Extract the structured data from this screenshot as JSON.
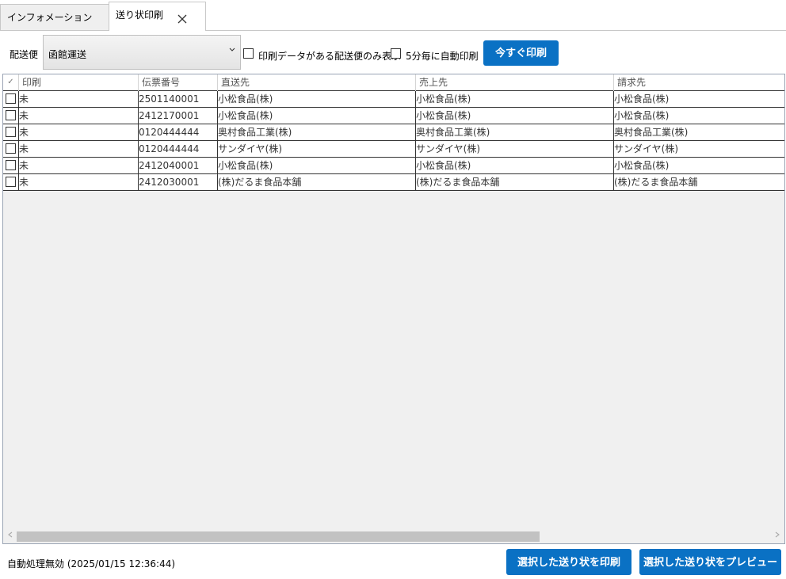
{
  "tabs": [
    {
      "label": "インフォメーション",
      "active": false
    },
    {
      "label": "送り状印刷",
      "active": true
    }
  ],
  "toolbar": {
    "carrier_label": "配送便",
    "carrier_value": "函館運送",
    "filter_label": "印刷データがある配送便のみ表示",
    "filter_checked": false,
    "auto_label": "5分毎に自動印刷",
    "auto_checked": false,
    "print_now_label": "今すぐ印刷"
  },
  "grid": {
    "columns": [
      "✓",
      "印刷",
      "伝票番号",
      "直送先",
      "売上先",
      "請求先"
    ],
    "rows": [
      {
        "checked": false,
        "printed": "未",
        "slip": "2501140001",
        "ship_to": "小松食品(株)",
        "sold_to": "小松食品(株)",
        "bill_to": "小松食品(株)"
      },
      {
        "checked": false,
        "printed": "未",
        "slip": "2412170001",
        "ship_to": "小松食品(株)",
        "sold_to": "小松食品(株)",
        "bill_to": "小松食品(株)"
      },
      {
        "checked": false,
        "printed": "未",
        "slip": "0120444444",
        "ship_to": "奥村食品工業(株)",
        "sold_to": "奥村食品工業(株)",
        "bill_to": "奥村食品工業(株)"
      },
      {
        "checked": false,
        "printed": "未",
        "slip": "0120444444",
        "ship_to": "サンダイヤ(株)",
        "sold_to": "サンダイヤ(株)",
        "bill_to": "サンダイヤ(株)"
      },
      {
        "checked": false,
        "printed": "未",
        "slip": "2412040001",
        "ship_to": "小松食品(株)",
        "sold_to": "小松食品(株)",
        "bill_to": "小松食品(株)"
      },
      {
        "checked": false,
        "printed": "未",
        "slip": "2412030001",
        "ship_to": "(株)だるま食品本舗",
        "sold_to": "(株)だるま食品本舗",
        "bill_to": "(株)だるま食品本舗"
      }
    ]
  },
  "status": {
    "text": "自動処理無効 (2025/01/15 12:36:44)"
  },
  "footer": {
    "print_selected_label": "選択した送り状を印刷",
    "preview_selected_label": "選択した送り状をプレビュー"
  },
  "colors": {
    "accent": "#0a71c4",
    "grid_background": "#f0f0f0"
  },
  "icons": {
    "tab_close": "close-icon",
    "dropdown": "chevron-down-icon",
    "scroll_left": "arrow-left-icon",
    "scroll_right": "arrow-right-icon"
  }
}
